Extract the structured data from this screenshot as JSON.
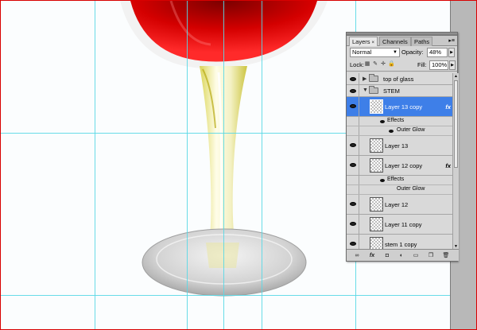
{
  "panel": {
    "tabs": [
      {
        "label": "Layers",
        "close": "×"
      },
      {
        "label": "Channels"
      },
      {
        "label": "Paths"
      }
    ],
    "menu_glyph": "▸≡",
    "blend_mode": "Normal",
    "opacity_label": "Opacity:",
    "opacity_value": "48%",
    "lock_label": "Lock:",
    "fill_label": "Fill:",
    "fill_value": "100%"
  },
  "layers": {
    "top_of_glass": {
      "name": "top of glass",
      "disclosure": "▶"
    },
    "stem": {
      "name": "STEM",
      "disclosure": "▼"
    },
    "layer13copy": {
      "name": "Layer 13 copy",
      "fx": "fx"
    },
    "effects1": "Effects",
    "outerglow1": "Outer Glow",
    "layer13": {
      "name": "Layer 13"
    },
    "layer12copy": {
      "name": "Layer 12 copy",
      "fx": "fx"
    },
    "effects2": "Effects",
    "outerglow2": "Outer Glow",
    "layer12": {
      "name": "Layer 12"
    },
    "layer11copy": {
      "name": "Layer 11 copy"
    },
    "stem1copy": {
      "name": "stem 1 copy"
    }
  },
  "colors": {
    "selection": "#3e7fe8",
    "guide": "#59d8e6",
    "wine_red": "#e00000"
  }
}
